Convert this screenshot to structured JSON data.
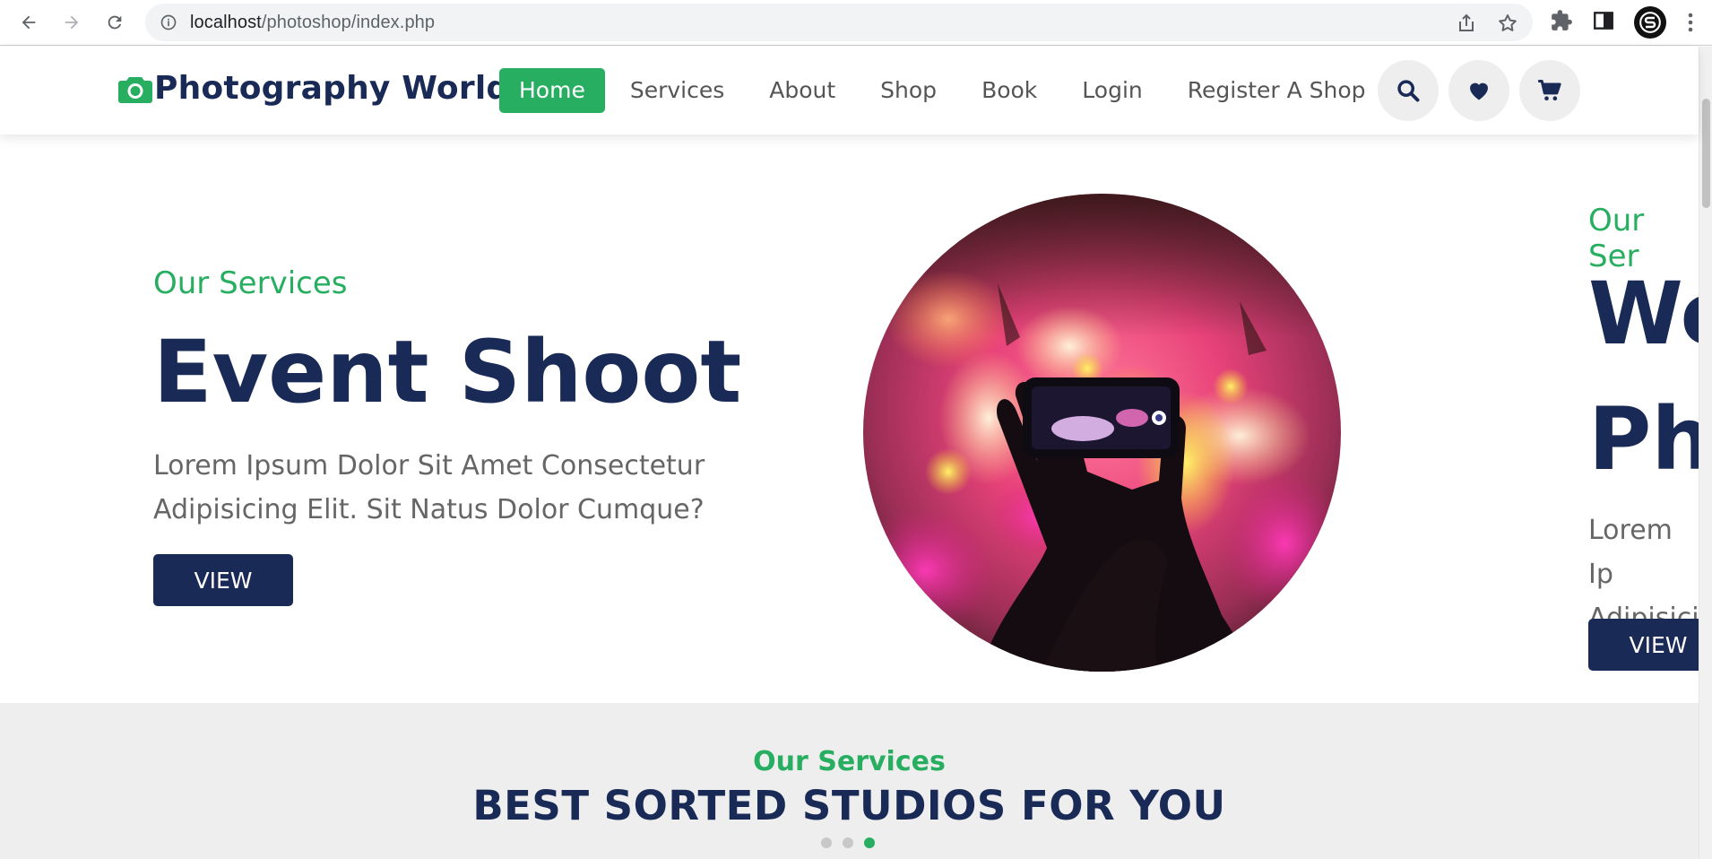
{
  "browser": {
    "url_host": "localhost",
    "url_path": "/photoshop/index.php"
  },
  "header": {
    "logo_text": "Photography World.",
    "nav": [
      {
        "label": "Home",
        "active": true
      },
      {
        "label": "Services",
        "active": false
      },
      {
        "label": "About",
        "active": false
      },
      {
        "label": "Shop",
        "active": false
      },
      {
        "label": "Book",
        "active": false
      },
      {
        "label": "Login",
        "active": false
      },
      {
        "label": "Register A Shop",
        "active": false
      }
    ],
    "icons": [
      "search-icon",
      "heart-icon",
      "cart-icon"
    ]
  },
  "hero": {
    "current_slide": {
      "subtitle": "Our Services",
      "title": "Event Shoot",
      "text_line1": "Lorem Ipsum Dolor Sit Amet Consectetur",
      "text_line2": "Adipisicing Elit. Sit Natus Dolor Cumque?",
      "button": "VIEW"
    },
    "next_slide": {
      "subtitle": "Our Ser",
      "title_line1": "We",
      "title_line2": "Ph",
      "text_line1": "Lorem Ip",
      "text_line2": "Adipisici",
      "button": "VIEW"
    }
  },
  "services": {
    "subtitle": "Our Services",
    "title": "BEST SORTED STUDIOS FOR YOU",
    "dots": 3,
    "active_dot": 3
  },
  "colors": {
    "brand_green": "#27ae60",
    "navy": "#192a56",
    "section_bg": "#eeeeee"
  }
}
